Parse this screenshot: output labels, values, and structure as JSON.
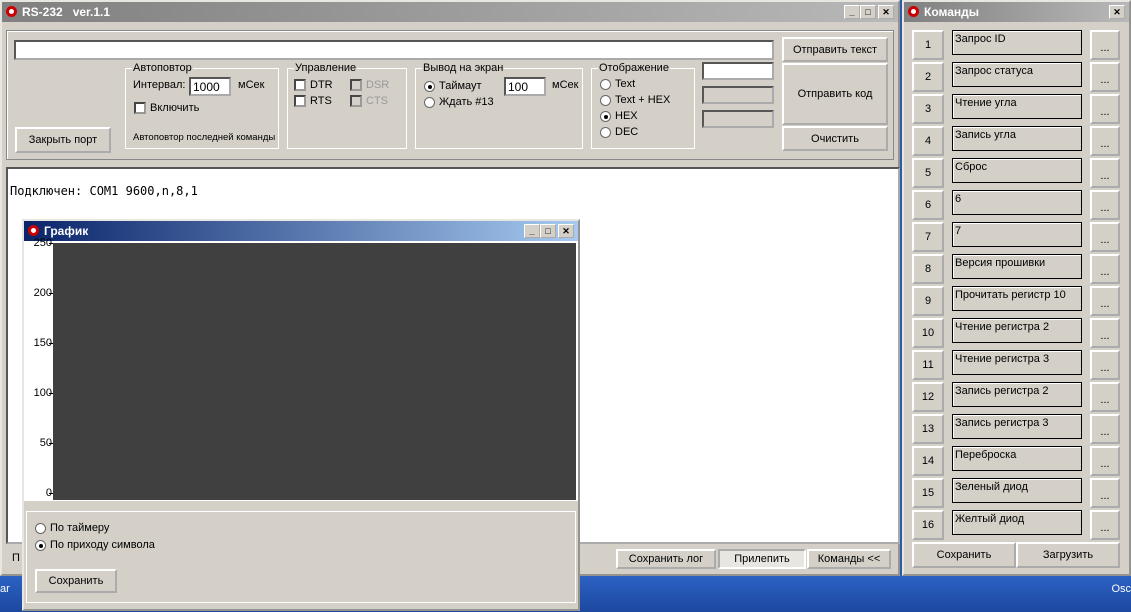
{
  "main": {
    "title": "RS-232   ver.1.1",
    "send_text": "Отправить текст",
    "send_code": "Отправить код",
    "clear": "Очистить",
    "close_port": "Закрыть порт",
    "autorepeat": {
      "label": "Автоповтор",
      "interval_label": "Интервал:",
      "interval": "1000",
      "unit": "мСек",
      "enable": "Включить",
      "note": "Автоповтор последней команды"
    },
    "control": {
      "label": "Управление",
      "dtr": "DTR",
      "rts": "RTS",
      "dsr": "DSR",
      "cts": "CTS"
    },
    "output": {
      "label": "Вывод на экран",
      "timeout": "Таймаут",
      "timeout_value": "100",
      "unit": "мСек",
      "wait": "Ждать #13"
    },
    "display": {
      "label": "Отображение",
      "options": [
        "Text",
        "Text + HEX",
        "HEX",
        "DEC"
      ],
      "selected": "HEX"
    },
    "log": "Подключен: COM1 9600,n,8,1",
    "bottom": {
      "left_text": "П",
      "save_log": "Сохранить лог",
      "attach": "Прилепить",
      "commands": "Команды <<"
    }
  },
  "commands": {
    "title": "Команды",
    "items": [
      {
        "n": "1",
        "name": "Запрос ID"
      },
      {
        "n": "2",
        "name": "Запрос статуса"
      },
      {
        "n": "3",
        "name": "Чтение угла"
      },
      {
        "n": "4",
        "name": "Запись угла"
      },
      {
        "n": "5",
        "name": "Сброс"
      },
      {
        "n": "6",
        "name": "6"
      },
      {
        "n": "7",
        "name": "7"
      },
      {
        "n": "8",
        "name": "Версия прошивки"
      },
      {
        "n": "9",
        "name": "Прочитать регистр 10"
      },
      {
        "n": "10",
        "name": "Чтение регистра 2"
      },
      {
        "n": "11",
        "name": "Чтение регистра 3"
      },
      {
        "n": "12",
        "name": "Запись регистра 2"
      },
      {
        "n": "13",
        "name": "Запись регистра 3"
      },
      {
        "n": "14",
        "name": "Переброска"
      },
      {
        "n": "15",
        "name": "Зеленый диод"
      },
      {
        "n": "16",
        "name": "Желтый диод"
      }
    ],
    "dots": "...",
    "save": "Сохранить",
    "load": "Загрузить"
  },
  "graph": {
    "title": "График",
    "chart_data": {
      "type": "line",
      "y_ticks": [
        "250",
        "200",
        "150",
        "100",
        "50",
        "0"
      ],
      "ylim": [
        0,
        250
      ],
      "series": []
    },
    "by_timer": "По таймеру",
    "by_symbol": "По приходу символа",
    "mode": "По приходу символа",
    "save": "Сохранить"
  },
  "taskbar": {
    "left": "ar",
    "right": "Osc"
  }
}
